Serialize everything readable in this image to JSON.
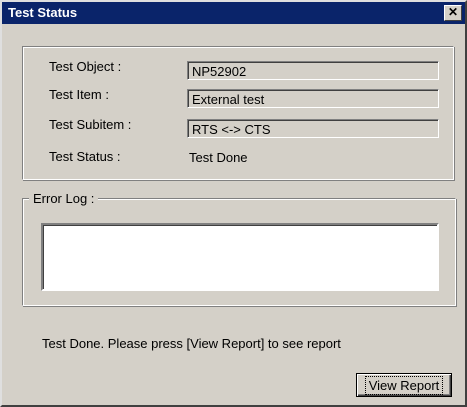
{
  "window": {
    "title": "Test Status",
    "close_glyph": "✕"
  },
  "fields": {
    "test_object_label": "Test Object :",
    "test_object_value": "NP52902",
    "test_item_label": "Test Item :",
    "test_item_value": "External test",
    "test_subitem_label": "Test Subitem :",
    "test_subitem_value": "RTS <-> CTS",
    "test_status_label": "Test Status :",
    "test_status_value": "Test Done"
  },
  "error_log": {
    "label": "Error Log :",
    "content": ""
  },
  "footer": {
    "message": "Test Done. Please press [View Report] to see report",
    "view_report_label": "View Report"
  },
  "colors": {
    "title_bar": "#0a246a",
    "dialog_face": "#d4d0c8"
  }
}
